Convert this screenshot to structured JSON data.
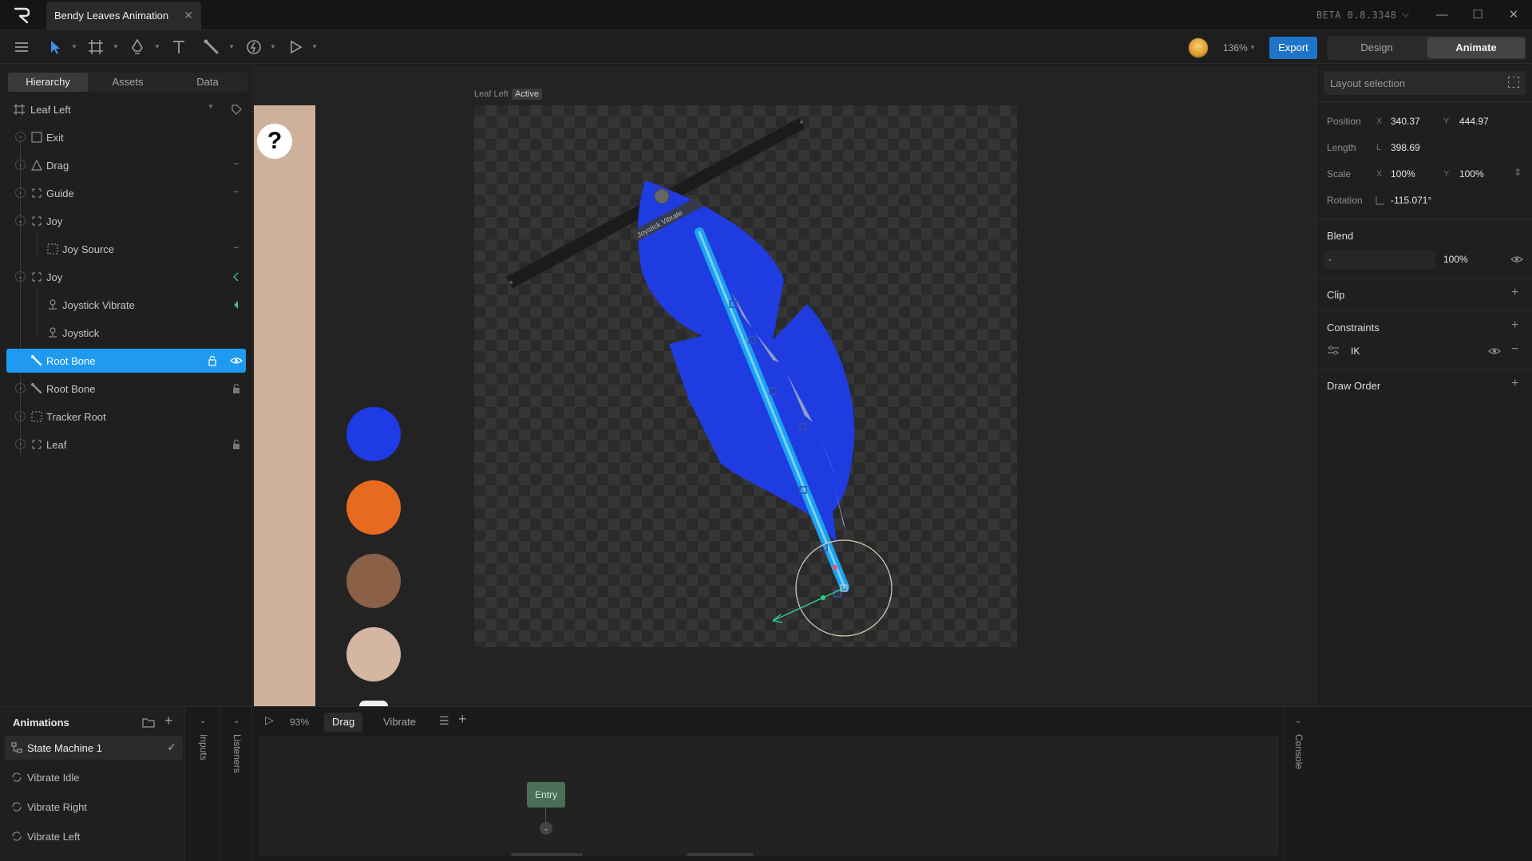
{
  "titlebar": {
    "document_title": "Bendy Leaves Animation",
    "close_tab": "✕",
    "version": "BETA 0.8.3348",
    "minimize": "—",
    "maximize": "☐",
    "close": "✕"
  },
  "toolbar": {
    "zoom": "136%",
    "export_label": "Export",
    "modes": {
      "design": "Design",
      "animate": "Animate"
    }
  },
  "left_tabs": [
    "Hierarchy",
    "Assets",
    "Data"
  ],
  "hierarchy": [
    {
      "label": "Leaf Left",
      "icon": "artboard-icon",
      "expanded": true
    },
    {
      "label": "Exit",
      "icon": "shape-icon"
    },
    {
      "label": "Drag",
      "icon": "triangle-icon",
      "right_icon": "eye-closed-icon"
    },
    {
      "label": "Guide",
      "icon": "group-icon",
      "right_icon": "eye-closed-icon"
    },
    {
      "label": "Joy",
      "icon": "group-icon"
    },
    {
      "label": "Joy Source",
      "icon": "target-icon",
      "right_icon": "eye-closed-icon"
    },
    {
      "label": "Joy",
      "icon": "group-icon",
      "right_icon": "keyframe-icon"
    },
    {
      "label": "Joystick Vibrate",
      "icon": "joystick-icon",
      "right_icon": "keyframe-icon"
    },
    {
      "label": "Joystick",
      "icon": "joystick-icon"
    },
    {
      "label": "Root Bone",
      "icon": "bone-icon",
      "selected": true,
      "right_icons": [
        "lock-icon",
        "eye-icon"
      ]
    },
    {
      "label": "Root Bone",
      "icon": "bone-icon",
      "right_icon": "lock-icon"
    },
    {
      "label": "Tracker Root",
      "icon": "target-icon"
    },
    {
      "label": "Leaf",
      "icon": "group-icon",
      "right_icon": "lock-icon"
    }
  ],
  "canvas": {
    "artboard_name": "Leaf Left",
    "artboard_badge": "Active",
    "help_glyph": "?",
    "joystick_label": "Joystick Vibrate",
    "swatches": [
      "#1e3be6",
      "#e86a1e",
      "#8a6146",
      "#d5b6a3"
    ],
    "leaf_color": "#1f3ce0",
    "bone_color": "#29a8f5"
  },
  "properties": {
    "layout_selection": "Layout selection",
    "position": {
      "label": "Position",
      "x_axis": "X",
      "x": "340.37",
      "y_axis": "Y",
      "y": "444.97"
    },
    "length": {
      "label": "Length",
      "axis": "L",
      "value": "398.69"
    },
    "scale": {
      "label": "Scale",
      "x_axis": "X",
      "x": "100%",
      "y_axis": "Y",
      "y": "100%"
    },
    "rotation": {
      "label": "Rotation",
      "value": "-115.071°"
    },
    "blend": {
      "title": "Blend",
      "mode": "-",
      "opacity": "100%"
    },
    "clip": {
      "title": "Clip"
    },
    "constraints": {
      "title": "Constraints",
      "items": [
        "IK"
      ]
    },
    "draw_order": {
      "title": "Draw Order"
    }
  },
  "animations": {
    "title": "Animations",
    "items": [
      {
        "label": "State Machine 1",
        "type": "state-machine",
        "selected": true
      },
      {
        "label": "Vibrate Idle",
        "type": "loop"
      },
      {
        "label": "Vibrate Right",
        "type": "loop"
      },
      {
        "label": "Vibrate Left",
        "type": "loop"
      }
    ],
    "inputs_label": "Inputs",
    "listeners_label": "Listeners",
    "console_label": "Console"
  },
  "state_machine": {
    "playback_zoom": "93%",
    "layers": [
      "Drag",
      "Vibrate"
    ],
    "active_layer": "Drag",
    "entry_label": "Entry"
  }
}
